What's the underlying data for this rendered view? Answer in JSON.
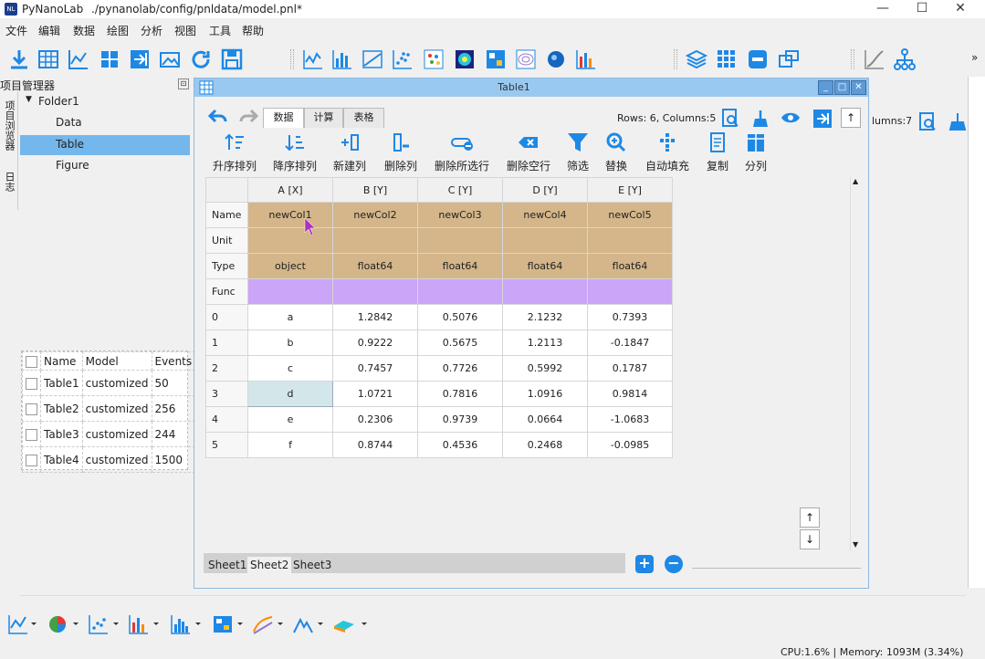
{
  "app": {
    "title": "PyNanoLab",
    "logo_text": "NL",
    "document_path": "./pynanolab/config/pnldata/model.pnl*",
    "window_controls": [
      "—",
      "☐",
      "✕"
    ]
  },
  "menu": [
    "文件",
    "编辑",
    "数据",
    "绘图",
    "分析",
    "视图",
    "工具",
    "帮助"
  ],
  "toolbar": {
    "icons": [
      "import-icon",
      "table-grid-icon",
      "chart-preview-icon",
      "split-icon",
      "export-icon",
      "photo-icon",
      "refresh-icon",
      "save-icon",
      "line-chart-icon",
      "bar-chart-icon",
      "area-chart-icon",
      "scatter-icon",
      "dot-matrix-icon",
      "heatmap-icon",
      "image-grid-icon",
      "contour-icon",
      "blob-icon",
      "column-chart-icon",
      "layers-icon",
      "apps-grid-icon",
      "minus-icon",
      "window-icon",
      "curve-icon",
      "tree-icon"
    ],
    "overflow": "»"
  },
  "sidebar": {
    "title": "项目管理器",
    "pin": "⊡",
    "side_tabs": [
      "项目浏览器",
      "日志"
    ],
    "tree": {
      "folder": "Folder1",
      "items": [
        "Data",
        "Table",
        "Figure"
      ],
      "selected": "Table"
    },
    "table_list": {
      "headers": [
        "Name",
        "Model",
        "Events"
      ],
      "rows": [
        {
          "name": "Table1",
          "model": "customized",
          "events": "50"
        },
        {
          "name": "Table2",
          "model": "customized",
          "events": "256"
        },
        {
          "name": "Table3",
          "model": "customized",
          "events": "244"
        },
        {
          "name": "Table4",
          "model": "customized",
          "events": "1500"
        }
      ]
    }
  },
  "bg_window": {
    "columns_text": "lumns:7"
  },
  "subwindow": {
    "title": "Table1",
    "controls": [
      "_",
      "□",
      "✕"
    ],
    "tabs": [
      "数据",
      "计算",
      "表格"
    ],
    "active_tab": "数据",
    "rows_columns": "Rows: 6, Columns:5",
    "ribbon": [
      "升序排列",
      "降序排列",
      "新建列",
      "删除列",
      "删除所选行",
      "删除空行",
      "筛选",
      "替换",
      "自动填充",
      "复制",
      "分列"
    ],
    "grid": {
      "column_headers": [
        "A [X]",
        "B [Y]",
        "C [Y]",
        "D [Y]",
        "E [Y]"
      ],
      "meta_labels": [
        "Name",
        "Unit",
        "Type",
        "Func"
      ],
      "names": [
        "newCol1",
        "newCol2",
        "newCol3",
        "newCol4",
        "newCol5"
      ],
      "units": [
        "",
        "",
        "",
        "",
        ""
      ],
      "types": [
        "object",
        "float64",
        "float64",
        "float64",
        "float64"
      ],
      "rows": [
        {
          "idx": "0",
          "cells": [
            "a",
            "1.2842",
            "0.5076",
            "2.1232",
            "0.7393"
          ]
        },
        {
          "idx": "1",
          "cells": [
            "b",
            "0.9222",
            "0.5675",
            "1.2113",
            "-0.1847"
          ]
        },
        {
          "idx": "2",
          "cells": [
            "c",
            "0.7457",
            "0.7726",
            "0.5992",
            "0.1787"
          ]
        },
        {
          "idx": "3",
          "cells": [
            "d",
            "1.0721",
            "0.7816",
            "1.0916",
            "0.9814"
          ]
        },
        {
          "idx": "4",
          "cells": [
            "e",
            "0.2306",
            "0.9739",
            "0.0664",
            "-1.0683"
          ]
        },
        {
          "idx": "5",
          "cells": [
            "f",
            "0.8744",
            "0.4536",
            "0.2468",
            "-0.0985"
          ]
        }
      ],
      "selected_row": "3"
    },
    "sheets": [
      "Sheet1",
      "Sheet2",
      "Sheet3"
    ],
    "active_sheet": "Sheet2",
    "add_sheet": "+",
    "remove_sheet": "−",
    "nav_up": "↑",
    "nav_down": "↓"
  },
  "bottom_toolbar": [
    "line-chart-icon",
    "pie-chart-icon",
    "scatter-icon",
    "bar-chart-icon",
    "histogram-icon",
    "heatmap-icon",
    "surface-icon",
    "peak-icon",
    "3d-surface-icon"
  ],
  "status": {
    "text": "CPU:1.6% | Memory: 1093M (3.34%)"
  },
  "colors": {
    "accent": "#1e88e5",
    "selection": "#74b7ec",
    "meta_row": "#d4b68a",
    "func_row": "#cba5f7",
    "subwindow_title": "#99c9f0"
  }
}
